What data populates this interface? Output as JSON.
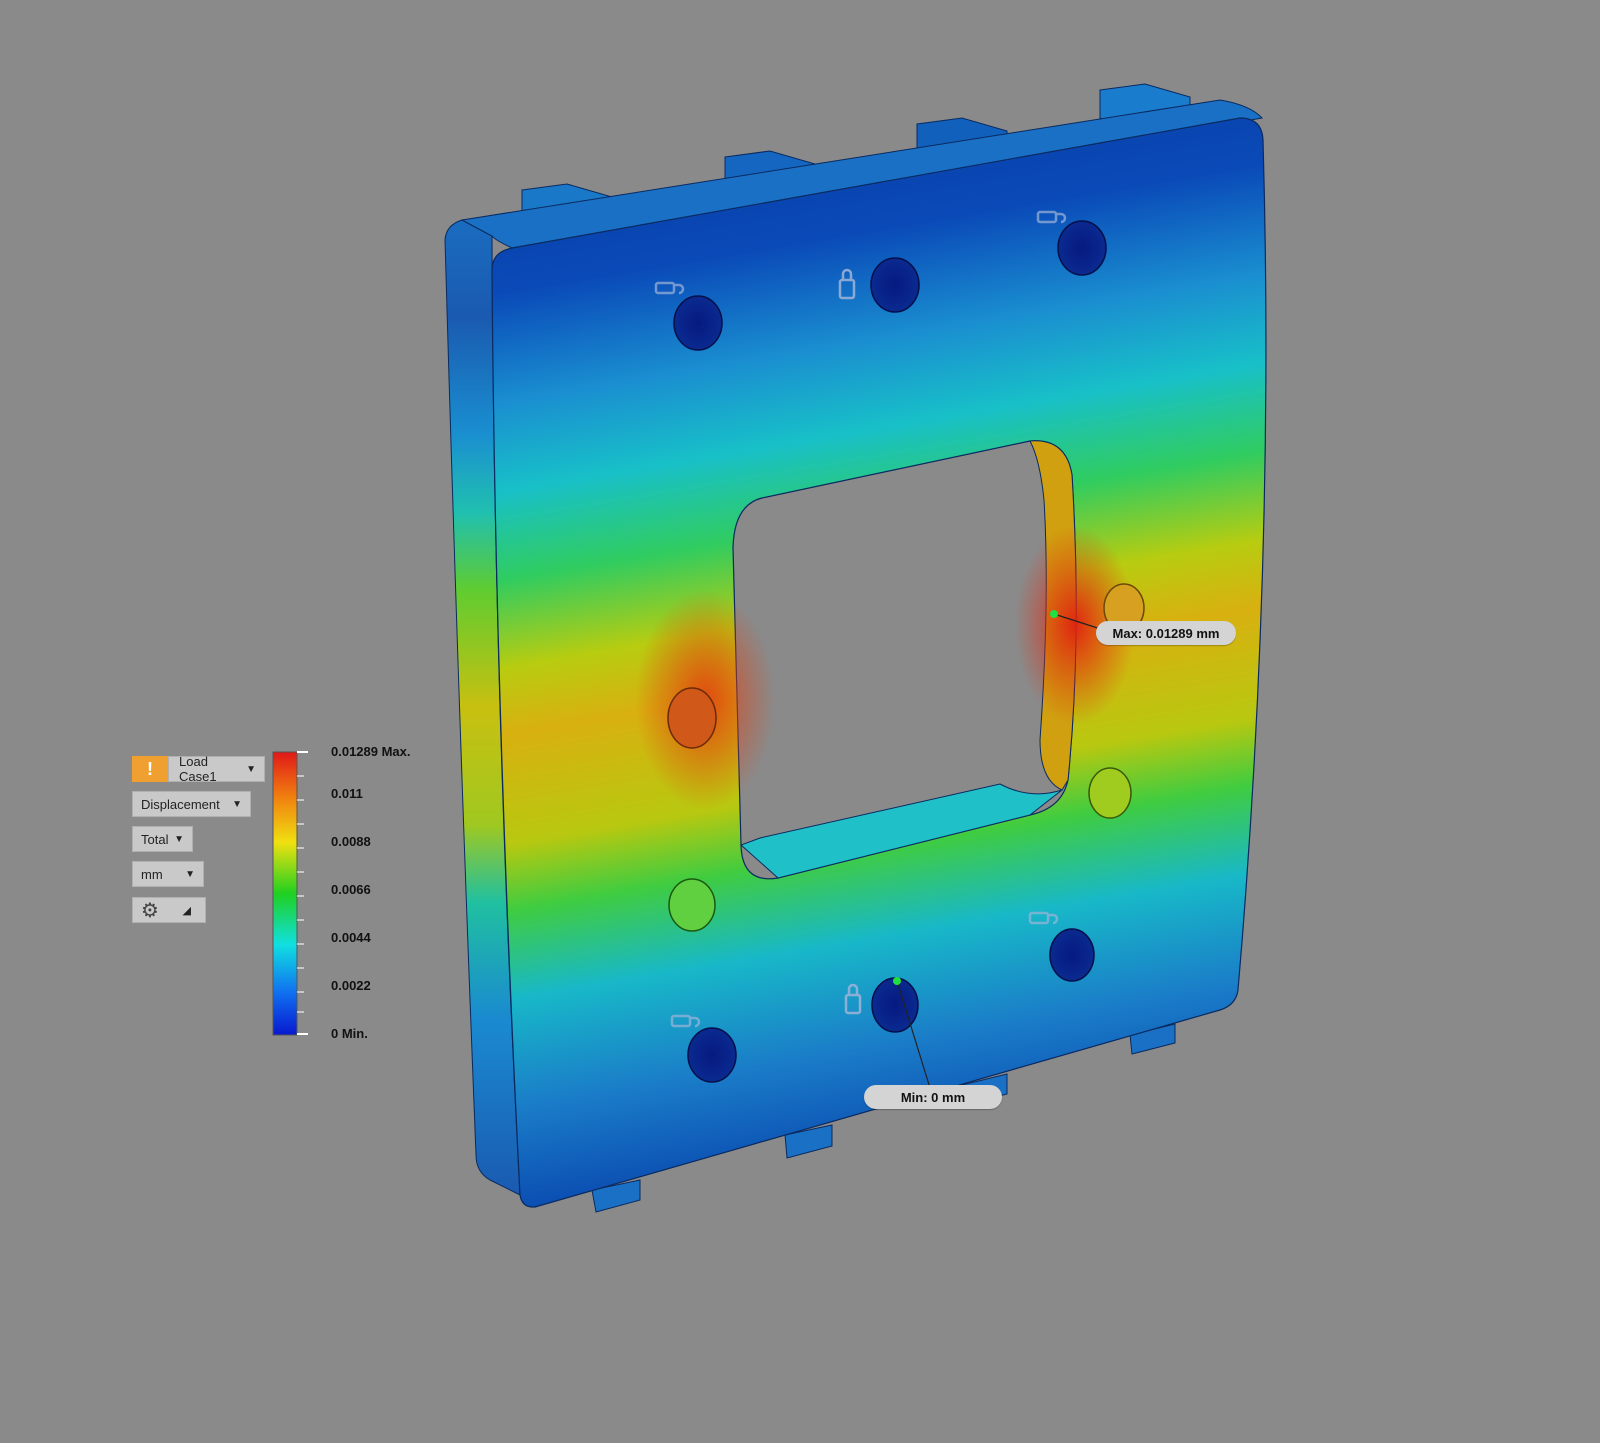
{
  "controls": {
    "warning_icon": "!",
    "load_case": "Load Case1",
    "result_type": "Displacement",
    "component": "Total",
    "units": "mm",
    "settings_icon": "gear-icon",
    "expand_icon": "triangle-icon"
  },
  "legend": {
    "labels": [
      "0.01289 Max.",
      "0.011",
      "0.0088",
      "0.0066",
      "0.0044",
      "0.0022",
      "0 Min."
    ],
    "colors": [
      "#e01818",
      "#f07a10",
      "#f0e010",
      "#20d020",
      "#10e0e0",
      "#1070f0",
      "#0818d0"
    ]
  },
  "callouts": {
    "max": "Max: 0.01289 mm",
    "min": "Min: 0 mm"
  }
}
